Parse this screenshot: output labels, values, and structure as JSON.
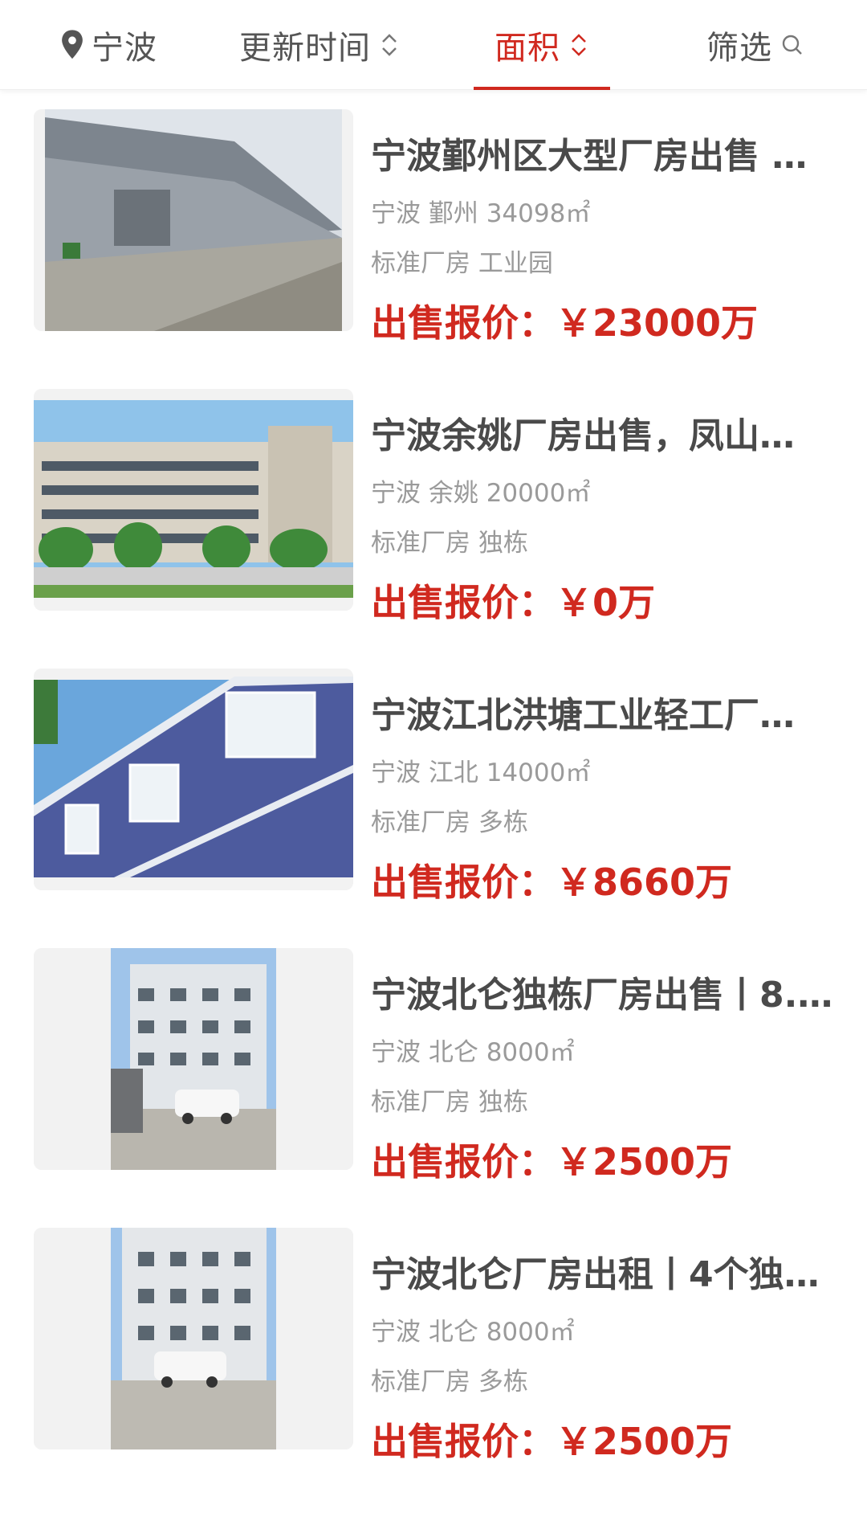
{
  "header": {
    "location": "宁波",
    "sort_update": "更新时间",
    "sort_area": "面积",
    "filter": "筛选"
  },
  "colors": {
    "accent": "#d0291f",
    "text": "#4a4a4a",
    "muted": "#9a9a9a"
  },
  "price_label": "出售报价：",
  "listings": [
    {
      "title": "宁波鄞州区大型厂房出售 …",
      "meta": "宁波 鄞州 34098㎡",
      "tags": "标准厂房 工业园",
      "price": "￥23000万"
    },
    {
      "title": "宁波余姚厂房出售，凤山…",
      "meta": "宁波 余姚 20000㎡",
      "tags": "标准厂房 独栋",
      "price": "￥0万"
    },
    {
      "title": "宁波江北洪塘工业轻工厂…",
      "meta": "宁波 江北 14000㎡",
      "tags": "标准厂房 多栋",
      "price": "￥8660万"
    },
    {
      "title": "宁波北仑独栋厂房出售丨8.…",
      "meta": "宁波 北仑 8000㎡",
      "tags": "标准厂房 独栋",
      "price": "￥2500万"
    },
    {
      "title": "宁波北仑厂房出租丨4个独…",
      "meta": "宁波 北仑 8000㎡",
      "tags": "标准厂房 多栋",
      "price": "￥2500万"
    }
  ]
}
